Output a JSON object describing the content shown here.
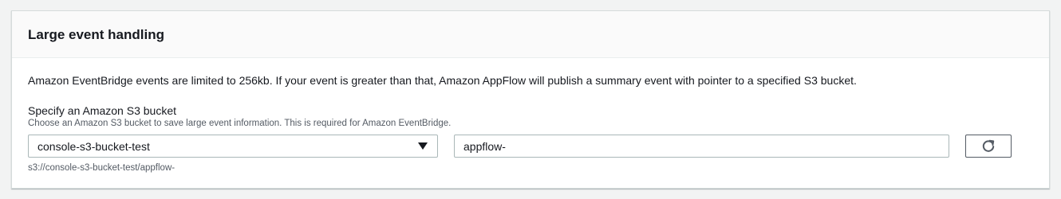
{
  "panel": {
    "title": "Large event handling",
    "description": "Amazon EventBridge events are limited to 256kb. If your event is greater than that, Amazon AppFlow will publish a summary event with pointer to a specified S3 bucket."
  },
  "bucket_field": {
    "label": "Specify an Amazon S3 bucket",
    "hint": "Choose an Amazon S3 bucket to save large event information. This is required for Amazon EventBridge.",
    "selected_bucket": "console-s3-bucket-test",
    "prefix_value": "appflow-",
    "path_preview": "s3://console-s3-bucket-test/appflow-"
  },
  "icons": {
    "dropdown": "caret-down-icon",
    "refresh": "refresh-icon"
  }
}
